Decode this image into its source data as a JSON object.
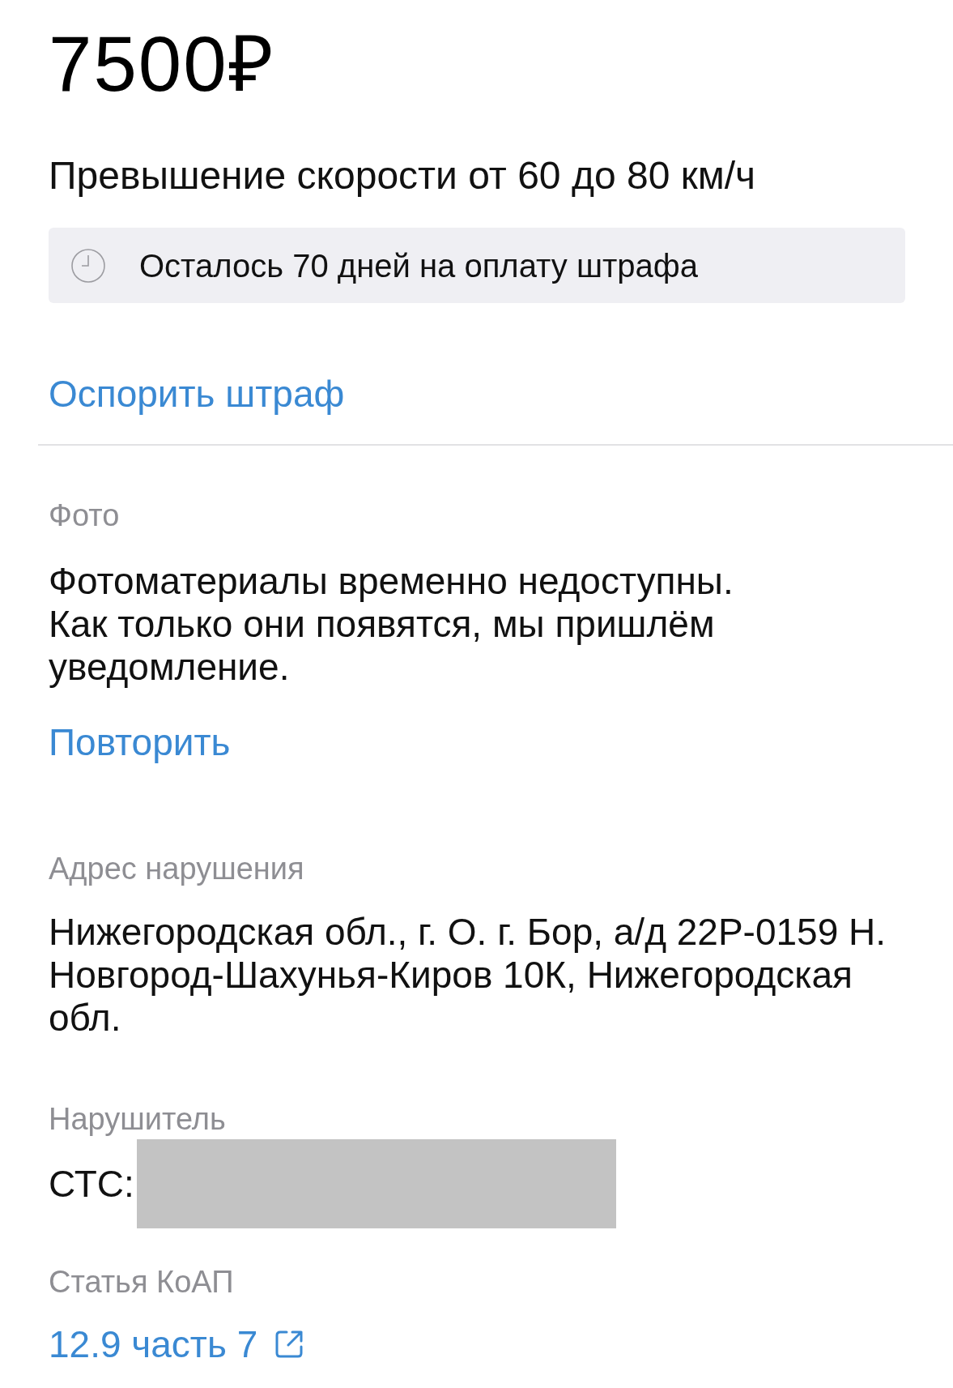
{
  "amount": "7500₽",
  "violation": "Превышение скорости от 60 до 80 км/ч",
  "deadline": "Осталось 70 дней на оплату штрафа",
  "dispute_link": "Оспорить штраф",
  "sections": [
    {
      "kind": "text",
      "label": "Фото",
      "text": "Фотоматериалы временно недоступны.\nКак только они появятся, мы пришлём уведомление.",
      "action": "Повторить"
    },
    {
      "kind": "text",
      "label": "Адрес нарушения",
      "text": "Нижегородская обл., г. О. г. Бор, а/д 22Р-0159 Н. Новгород-Шахунья-Киров 10К, Нижегородская обл."
    },
    {
      "kind": "field",
      "label": "Нарушитель",
      "field_label": "СТС:",
      "redacted": true
    },
    {
      "kind": "link",
      "label": "Статья КоАП",
      "link": "12.9 часть 7",
      "external": true
    }
  ]
}
